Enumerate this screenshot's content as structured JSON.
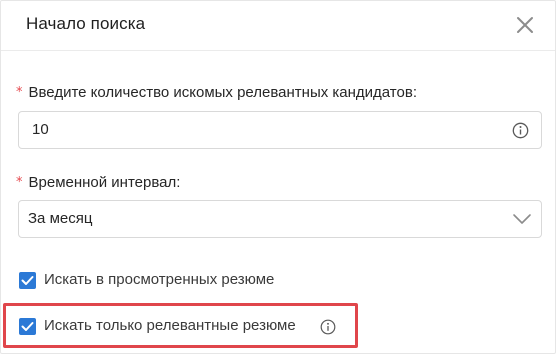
{
  "modal": {
    "title": "Начало поиска"
  },
  "form": {
    "candidates_label": "Введите количество искомых релевантных кандидатов",
    "candidates_value": "10",
    "interval_label": "Временной интервал",
    "interval_value": "За месяц",
    "label_suffix": ":",
    "required_mark": "*"
  },
  "options": {
    "viewed_label": "Искать в просмотренных резюме",
    "viewed_checked": true,
    "relevant_label": "Искать только релевантные резюме",
    "relevant_checked": true
  },
  "colors": {
    "accent": "#2b79d6",
    "required": "#e5484d",
    "highlight": "#e0464b"
  },
  "icons": {
    "close": "close-icon",
    "info": "info-icon",
    "chevron": "chevron-down-icon",
    "check": "check-icon"
  }
}
